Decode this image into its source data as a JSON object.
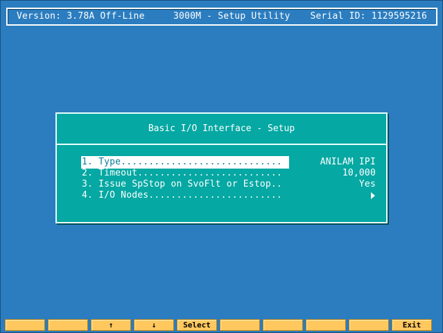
{
  "header": {
    "version": "Version: 3.78A Off-Line",
    "title": "3000M - Setup Utility",
    "serial": "Serial ID: 1129595216"
  },
  "dialog": {
    "title": "Basic I/O Interface - Setup",
    "items": [
      {
        "label": "1. Type.............................",
        "value": "ANILAM IPI",
        "selected": true
      },
      {
        "label": "2. Timeout..........................",
        "value": "10,000",
        "selected": false
      },
      {
        "label": "3. Issue SpStop on SvoFlt or Estop..",
        "value": "Yes",
        "selected": false
      },
      {
        "label": "4. I/O Nodes........................",
        "value": "",
        "selected": false,
        "icon": "arrow-right-icon"
      }
    ]
  },
  "softkeys": [
    {
      "label": ""
    },
    {
      "label": ""
    },
    {
      "label": "↑"
    },
    {
      "label": "↓"
    },
    {
      "label": "Select"
    },
    {
      "label": ""
    },
    {
      "label": ""
    },
    {
      "label": ""
    },
    {
      "label": ""
    },
    {
      "label": "Exit"
    }
  ],
  "colors": {
    "background": "#2b7dbf",
    "dialog": "#05a8a3",
    "selection": "#ffffff",
    "softkey": "#ffc85f"
  }
}
